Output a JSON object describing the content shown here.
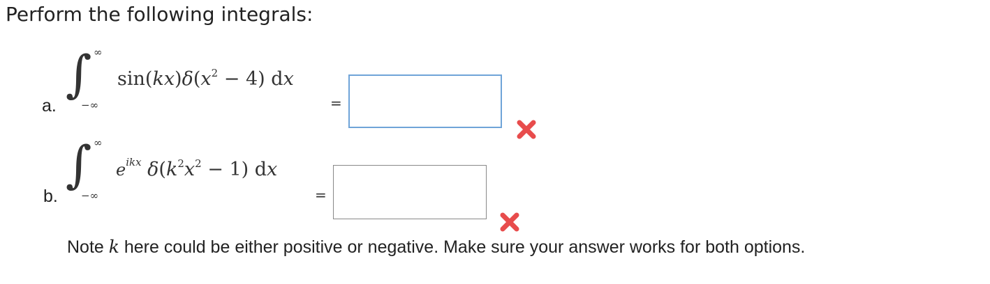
{
  "heading": "Perform the following integrals:",
  "icons": {
    "wrong": "x-mark-icon",
    "wrong_color": "#e84c4c"
  },
  "parts": [
    {
      "label": "a.",
      "upper_limit": "∞",
      "lower_limit": "−∞",
      "integrand": {
        "func": "sin",
        "open": "(",
        "k": "k",
        "x": "x",
        "close": ")",
        "delta": "δ",
        "arg_open": "(",
        "x2": "x",
        "power": "2",
        "rest": " − 4)",
        "d": " d",
        "dx_var": "x"
      },
      "equals": "=",
      "answer": ""
    },
    {
      "label": "b.",
      "upper_limit": "∞",
      "lower_limit": "−∞",
      "integrand": {
        "e": "e",
        "exponent": "ikx",
        "delta": "δ",
        "arg_open": "(",
        "k": "k",
        "kpow": "2",
        "x": "x",
        "xpow": "2",
        "rest": " − 1)",
        "d": " d",
        "dx_var": "x"
      },
      "equals": "=",
      "answer": ""
    }
  ],
  "note": {
    "before": "Note ",
    "k": "k",
    "after": " here could be either positive or negative. Make sure your answer works for both options."
  }
}
